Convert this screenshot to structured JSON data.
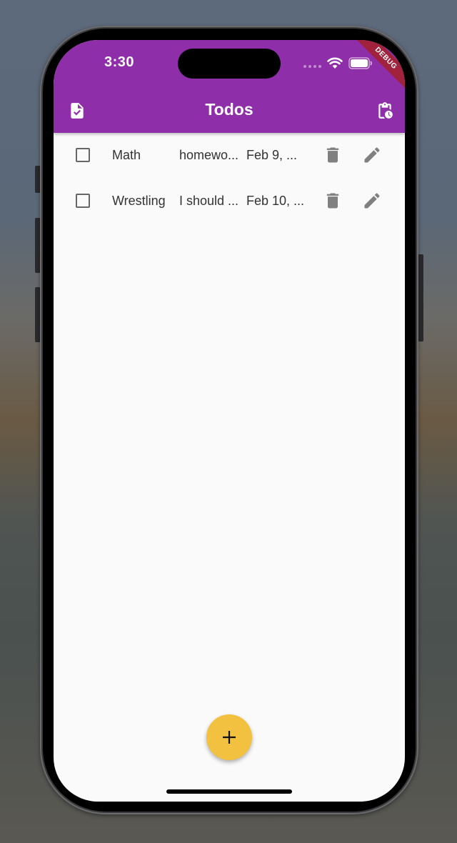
{
  "status_bar": {
    "time": "3:30"
  },
  "app_bar": {
    "title": "Todos",
    "left_icon": "task-file-icon",
    "right_icon": "clipboard-clock-icon",
    "color": "#8e2fa9",
    "debug_banner": "DEBUG"
  },
  "todos": [
    {
      "checked": false,
      "title": "Math",
      "description": "homewo...",
      "date": "Feb 9, ..."
    },
    {
      "checked": false,
      "title": "Wrestling",
      "description": "I should ...",
      "date": "Feb 10, ..."
    }
  ],
  "fab": {
    "label": "+",
    "color": "#f2c13f"
  }
}
